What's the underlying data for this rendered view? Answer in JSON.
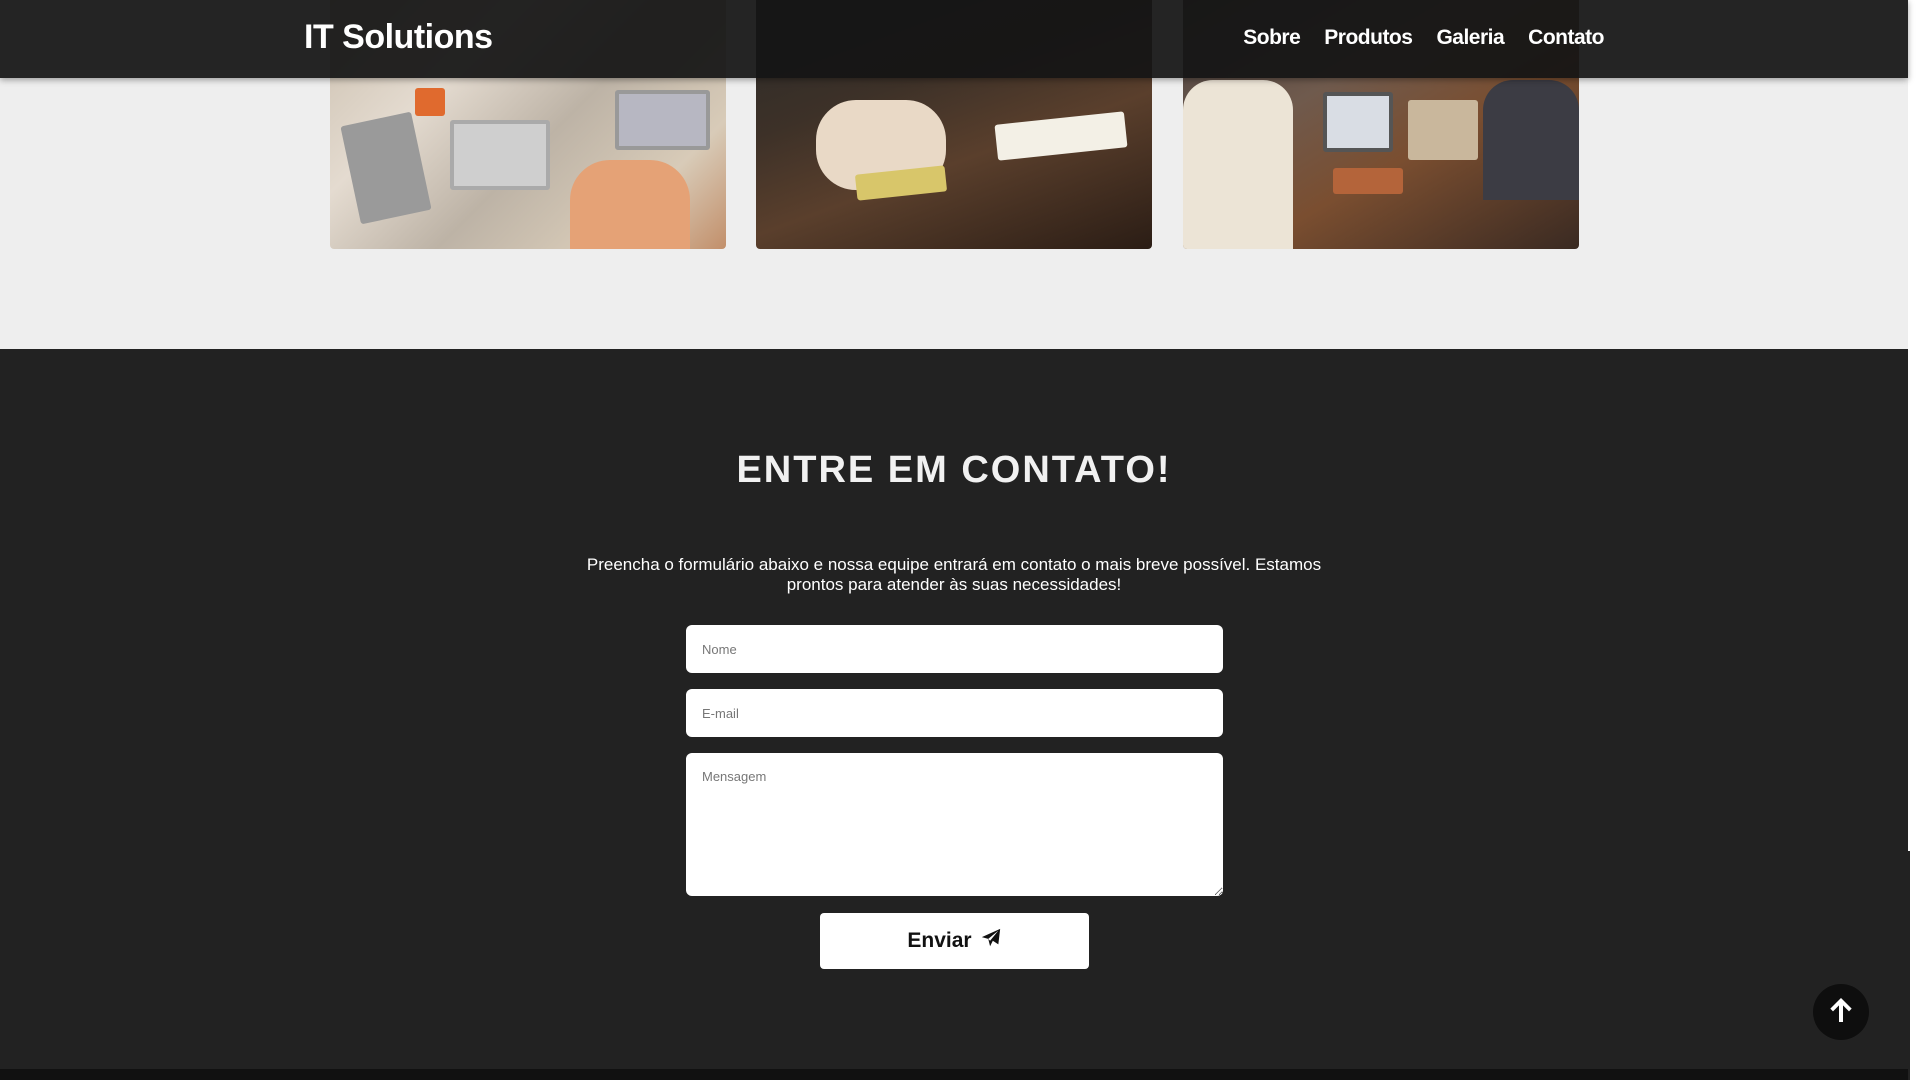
{
  "navbar": {
    "brand": "IT Solutions",
    "links": [
      {
        "label": "Sobre"
      },
      {
        "label": "Produtos"
      },
      {
        "label": "Galeria"
      },
      {
        "label": "Contato"
      }
    ]
  },
  "gallery": {
    "images": [
      {
        "description": "workspace-desk-laptops"
      },
      {
        "description": "meeting-table-notebook"
      },
      {
        "description": "team-at-table-laptops"
      }
    ]
  },
  "contact": {
    "title": "ENTRE EM CONTATO!",
    "text": "Preencha o formulário abaixo e nossa equipe entrará em contato o mais breve possível. Estamos prontos para atender às suas necessidades!",
    "form": {
      "name_placeholder": "Nome",
      "email_placeholder": "E-mail",
      "message_placeholder": "Mensagem",
      "submit_label": "Enviar",
      "submit_icon": "paper-plane-icon"
    }
  },
  "scroll_top": {
    "icon": "arrow-up-icon"
  },
  "colors": {
    "navbar_bg": "#141414",
    "contact_bg": "#222222",
    "gallery_bg": "#eeeeee",
    "button_bg": "#ffffff",
    "scroll_top_bg": "#0e0e0e"
  }
}
